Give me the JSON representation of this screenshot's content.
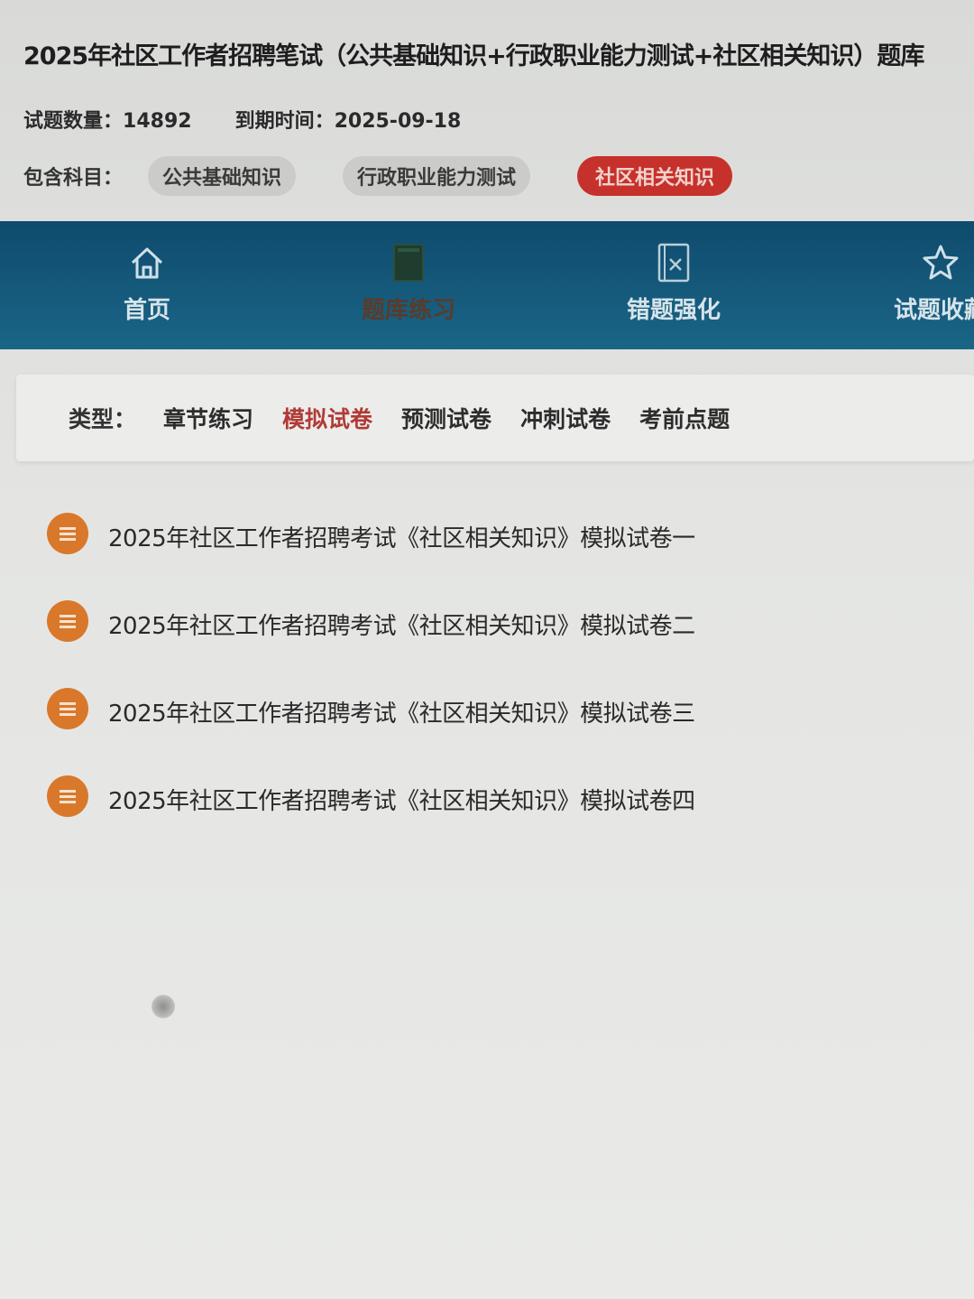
{
  "header": {
    "title": "2025年社区工作者招聘笔试（公共基础知识+行政职业能力测试+社区相关知识）题库",
    "question_count_label": "试题数量：",
    "question_count": "14892",
    "expiry_label": "到期时间：",
    "expiry_date": "2025-09-18",
    "subjects_label": "包含科目：",
    "subjects": [
      {
        "label": "公共基础知识",
        "active": false
      },
      {
        "label": "行政职业能力测试",
        "active": false
      },
      {
        "label": "社区相关知识",
        "active": true
      }
    ]
  },
  "nav": {
    "items": [
      {
        "label": "首页",
        "icon": "home-icon",
        "current": false
      },
      {
        "label": "题库练习",
        "icon": "book-icon",
        "current": true
      },
      {
        "label": "错题强化",
        "icon": "wrong-question-icon",
        "current": false
      },
      {
        "label": "试题收藏",
        "icon": "star-icon",
        "current": false
      }
    ]
  },
  "filter": {
    "label": "类型：",
    "options": [
      {
        "label": "章节练习",
        "active": false
      },
      {
        "label": "模拟试卷",
        "active": true
      },
      {
        "label": "预测试卷",
        "active": false
      },
      {
        "label": "冲刺试卷",
        "active": false
      },
      {
        "label": "考前点题",
        "active": false
      }
    ]
  },
  "papers": [
    {
      "title": "2025年社区工作者招聘考试《社区相关知识》模拟试卷一"
    },
    {
      "title": "2025年社区工作者招聘考试《社区相关知识》模拟试卷二"
    },
    {
      "title": "2025年社区工作者招聘考试《社区相关知识》模拟试卷三"
    },
    {
      "title": "2025年社区工作者招聘考试《社区相关知识》模拟试卷四"
    }
  ],
  "colors": {
    "nav_bg": "#0f4b6d",
    "accent_red": "#c7312b",
    "badge_orange": "#d9782a"
  }
}
